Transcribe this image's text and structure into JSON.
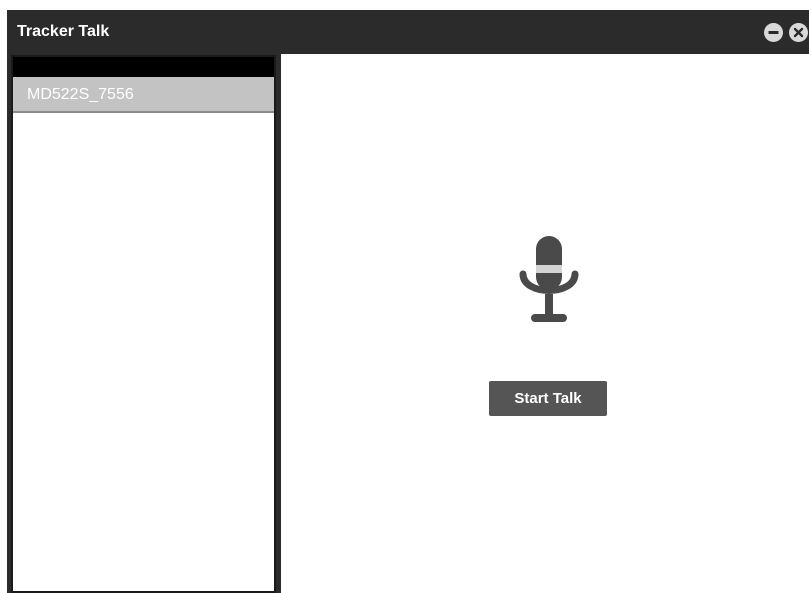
{
  "window": {
    "title": "Tracker Talk",
    "buttons": {
      "minimize_icon": "minus-circle-icon",
      "close_icon": "close-circle-icon"
    }
  },
  "sidebar": {
    "items": [
      {
        "label": "MD522S_7556",
        "selected": true
      }
    ]
  },
  "main": {
    "icon": "microphone-icon",
    "start_talk_label": "Start Talk"
  },
  "colors": {
    "titlebar": "#2b2b2b",
    "selected_item": "#c3c3c3",
    "button": "#555555",
    "icon": "#4a4a4a"
  }
}
